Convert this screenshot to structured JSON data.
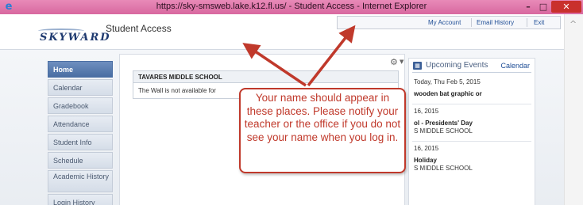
{
  "browser": {
    "title": "https://sky-smsweb.lake.k12.fl.us/ - Student Access - Internet Explorer"
  },
  "header": {
    "logo_text": "SKYWARD",
    "app_title": "Student Access",
    "account_links": [
      "My Account",
      "Email History",
      "Exit"
    ]
  },
  "sidebar": {
    "items": [
      {
        "label": "Home",
        "active": true
      },
      {
        "label": "Calendar",
        "active": false
      },
      {
        "label": "Gradebook",
        "active": false
      },
      {
        "label": "Attendance",
        "active": false
      },
      {
        "label": "Student Info",
        "active": false
      },
      {
        "label": "Schedule",
        "active": false
      },
      {
        "label": "Academic History",
        "active": false
      },
      {
        "label": "Login History",
        "active": false
      }
    ]
  },
  "wall": {
    "school_name": "TAVARES MIDDLE SCHOOL",
    "message": "The Wall is not available for"
  },
  "events": {
    "title": "Upcoming Events",
    "calendar_link": "Calendar",
    "today_label": "Today, Thu Feb 5, 2015",
    "item1": "wooden bat graphic or",
    "date2": "16, 2015",
    "item2_name": "ol - Presidents' Day",
    "item2_school": "S MIDDLE SCHOOL",
    "date3": "16, 2015",
    "item3_name": "Holiday",
    "item3_school": "S MIDDLE SCHOOL"
  },
  "annotation": {
    "text": "Your name should appear in these places. Please notify your teacher or the office if you do not see your name when you log in.",
    "color": "#c0392b"
  },
  "colors": {
    "titlebar": "#d8689f",
    "nav_active": "#4a6ea3",
    "link": "#1f4e96",
    "callout": "#c0392b"
  }
}
